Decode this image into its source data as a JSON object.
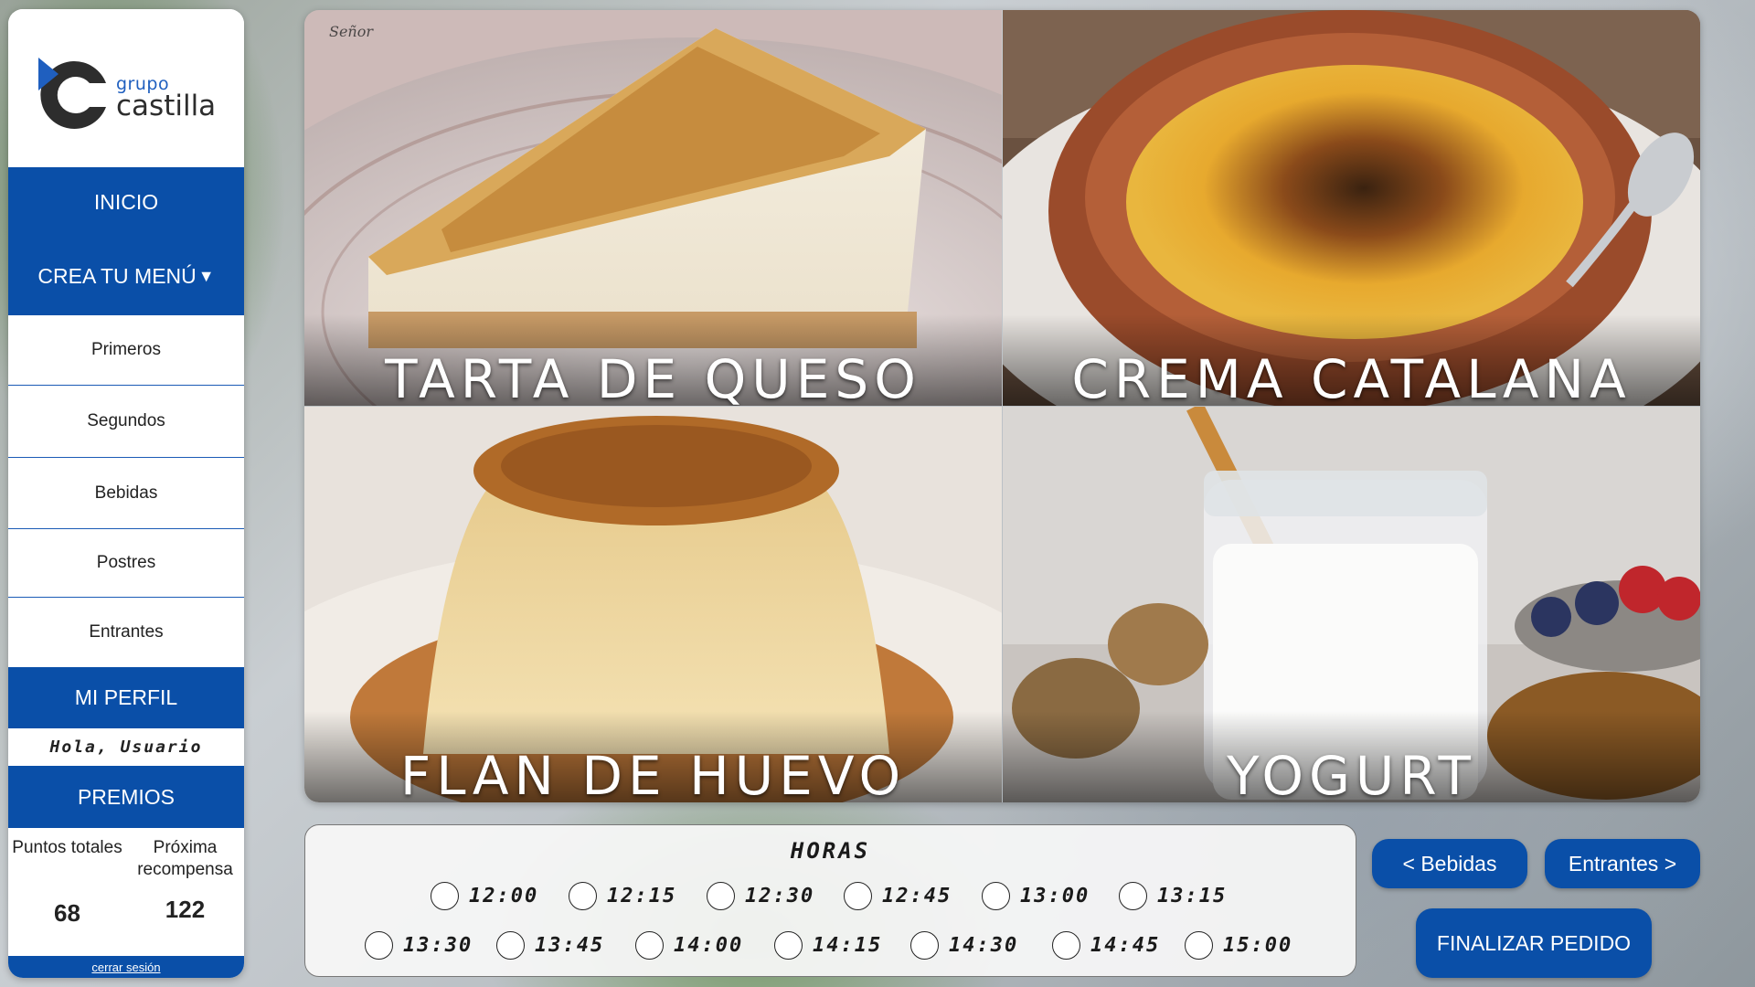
{
  "brand": {
    "small": "grupo",
    "big": "castilla",
    "color": "#0a4fa8"
  },
  "sidebar": {
    "inicio": "INICIO",
    "crea_menu": "CREA TU MENÚ",
    "crea_menu_caret": "▼",
    "submenu": [
      "Primeros",
      "Segundos",
      "Bebidas",
      "Postres",
      "Entrantes"
    ],
    "perfil": "MI PERFIL",
    "greeting": "Hola, Usuario",
    "premios": "PREMIOS",
    "points_total_label": "Puntos totales",
    "points_total_value": "68",
    "next_reward_label": "Próxima recompensa",
    "next_reward_value": "122",
    "logout": "cerrar sesión"
  },
  "desserts": {
    "watermark": "Señor",
    "items": [
      "TARTA DE QUESO",
      "CREMA CATALANA",
      "FLAN DE HUEVO",
      "YOGURT"
    ]
  },
  "horas": {
    "title": "HORAS",
    "row1": [
      "12:00",
      "12:15",
      "12:30",
      "12:45",
      "13:00",
      "13:15"
    ],
    "row2": [
      "13:30",
      "13:45",
      "14:00",
      "14:15",
      "14:30",
      "14:45",
      "15:00"
    ]
  },
  "buttons": {
    "prev": "< Bebidas",
    "next": "Entrantes >",
    "finish": "FINALIZAR PEDIDO"
  }
}
